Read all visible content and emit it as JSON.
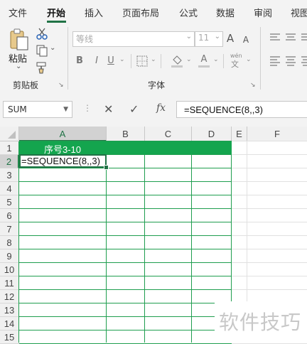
{
  "menu": {
    "tabs": [
      "文件",
      "开始",
      "插入",
      "页面布局",
      "公式",
      "数据",
      "审阅",
      "视图"
    ],
    "active": "开始"
  },
  "ribbon": {
    "clipboard": {
      "paste_label": "粘贴",
      "group_label": "剪贴板"
    },
    "font": {
      "font_name": "等线",
      "font_size": "11",
      "bold": "B",
      "italic": "I",
      "underline": "U",
      "grow": "A",
      "shrink": "A",
      "font_color": "A",
      "phonetic": "wén",
      "group_label": "字体"
    }
  },
  "formula_bar": {
    "name_box": "SUM",
    "cancel": "✕",
    "enter": "✓",
    "fx": "fx",
    "formula": "=SEQUENCE(8,,3)"
  },
  "sheet": {
    "columns": [
      "A",
      "B",
      "C",
      "D",
      "E",
      "F"
    ],
    "rows": [
      "1",
      "2",
      "3",
      "4",
      "5",
      "6",
      "7",
      "8",
      "9",
      "10",
      "11",
      "12",
      "13",
      "14",
      "15"
    ],
    "cells": {
      "A1": "序号3-10",
      "A2": "=SEQUENCE(8,,3)"
    }
  },
  "watermark": "软件技巧",
  "colors": {
    "accent": "#217346",
    "header_fill": "#14a54e",
    "border": "#1f9e4f"
  }
}
